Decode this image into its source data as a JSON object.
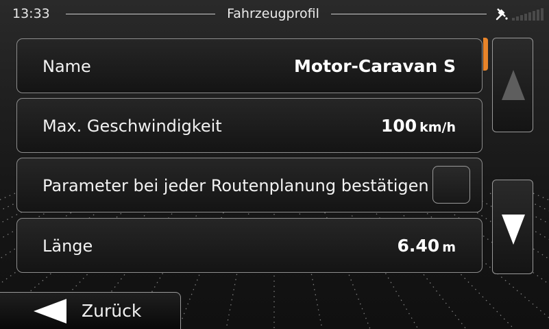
{
  "status_bar": {
    "time": "13:33",
    "title": "Fahrzeugprofil",
    "icons": [
      "gps-icon",
      "signal-strength-icon"
    ]
  },
  "rows": [
    {
      "label": "Name",
      "value": "Motor-Caravan S",
      "unit": ""
    },
    {
      "label": "Max. Geschwindigkeit",
      "value": "100",
      "unit": "km/h"
    },
    {
      "label": "Parameter bei jeder Routenplanung bestätigen",
      "checked": false
    },
    {
      "label": "Länge",
      "value": "6.40",
      "unit": "m"
    }
  ],
  "scroll": {
    "up_icon": "arrow-up-icon",
    "down_icon": "arrow-down-icon",
    "up_enabled": false,
    "down_enabled": true
  },
  "back": {
    "label": "Zurück",
    "icon": "arrow-left-icon"
  },
  "colors": {
    "accent": "#e8842a",
    "text": "#ffffff",
    "row_border": "#8d8d8d",
    "disabled_arrow": "#5e5e5e"
  }
}
